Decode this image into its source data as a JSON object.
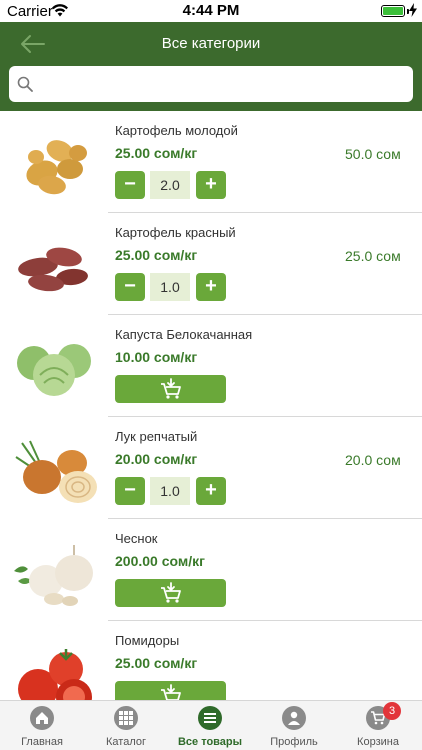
{
  "status_bar": {
    "carrier": "Carrier",
    "time": "4:44 PM"
  },
  "header": {
    "title": "Все категории"
  },
  "search": {
    "placeholder": "",
    "value": ""
  },
  "colors": {
    "header": "#3c6a2d",
    "accent": "#6aa83a",
    "price": "#3a7a2a",
    "badge": "#e2353a"
  },
  "products": [
    {
      "name": "Картофель молодой",
      "price": "25.00 сом/кг",
      "total": "50.0 сом",
      "quantity": "2.0",
      "image": "potato-image"
    },
    {
      "name": "Картофель красный",
      "price": "25.00 сом/кг",
      "total": "25.0 сом",
      "quantity": "1.0",
      "image": "red-potato-image"
    },
    {
      "name": "Капуста Белокачанная",
      "price": "10.00 сом/кг",
      "image": "cabbage-image"
    },
    {
      "name": "Лук репчатый",
      "price": "20.00 сом/кг",
      "total": "20.0 сом",
      "quantity": "1.0",
      "image": "onion-image"
    },
    {
      "name": "Чеснок",
      "price": "200.00 сом/кг",
      "image": "garlic-image"
    },
    {
      "name": "Помидоры",
      "price": "25.00 сом/кг",
      "image": "tomato-image"
    }
  ],
  "controls": {
    "minus": "−",
    "plus": "+"
  },
  "tabbar": {
    "tabs": [
      {
        "label": "Главная",
        "icon": "home-icon"
      },
      {
        "label": "Каталог",
        "icon": "grid-icon"
      },
      {
        "label": "Все товары",
        "icon": "list-icon",
        "active": true
      },
      {
        "label": "Профиль",
        "icon": "person-icon"
      },
      {
        "label": "Корзина",
        "icon": "cart-icon",
        "badge": "3"
      }
    ]
  }
}
